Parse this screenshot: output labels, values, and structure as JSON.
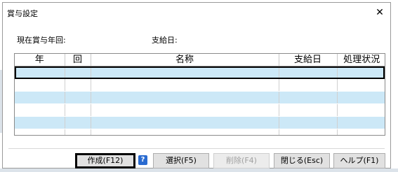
{
  "window": {
    "title": "賞与設定",
    "close_label": "✕"
  },
  "info": {
    "current_label": "現在賞与年回:",
    "current_value": "",
    "payday_label": "支給日:",
    "payday_value": ""
  },
  "table": {
    "columns": [
      "年",
      "回",
      "名称",
      "支給日",
      "処理状況"
    ],
    "rows": [
      [
        "",
        "",
        "",
        "",
        ""
      ],
      [
        "",
        "",
        "",
        "",
        ""
      ],
      [
        "",
        "",
        "",
        "",
        ""
      ],
      [
        "",
        "",
        "",
        "",
        ""
      ],
      [
        "",
        "",
        "",
        "",
        ""
      ],
      [
        "",
        "",
        "",
        "",
        ""
      ]
    ]
  },
  "buttons": {
    "create": "作成(F12)",
    "select": "選択(F5)",
    "delete": "削除(F4)",
    "close": "閉じる(Esc)",
    "help": "ヘルプ(F1)"
  },
  "help_icon": "?",
  "colors": {
    "row_highlight": "#cce8f7",
    "button_face": "#e1e1e1",
    "help_icon": "#2a6bd0"
  }
}
